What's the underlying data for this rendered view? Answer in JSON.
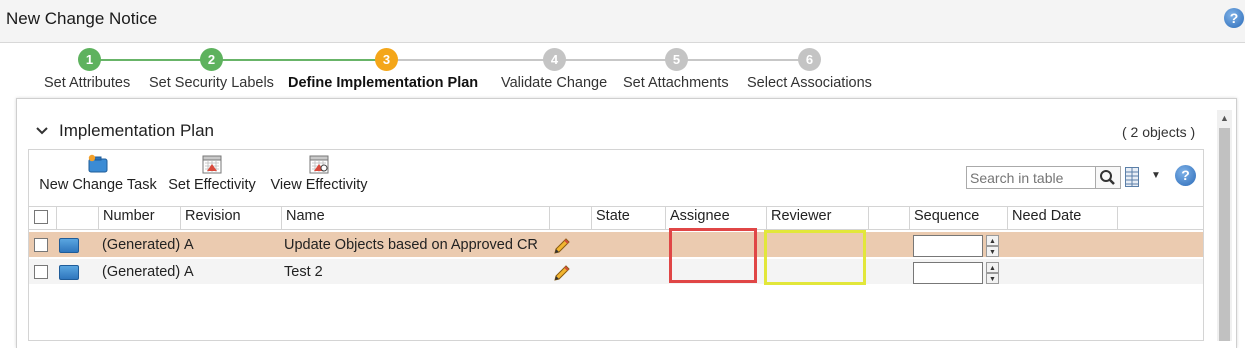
{
  "window": {
    "title": "New Change Notice",
    "help_icon": "?"
  },
  "wizard": {
    "steps": [
      {
        "number": "1",
        "label": "Set Attributes",
        "status": "complete"
      },
      {
        "number": "2",
        "label": "Set Security Labels",
        "status": "complete"
      },
      {
        "number": "3",
        "label": "Define Implementation Plan",
        "status": "active"
      },
      {
        "number": "4",
        "label": "Validate Change",
        "status": "pending"
      },
      {
        "number": "5",
        "label": "Set Attachments",
        "status": "pending"
      },
      {
        "number": "6",
        "label": "Select Associations",
        "status": "pending"
      }
    ]
  },
  "section": {
    "title": "Implementation Plan",
    "object_count": "( 2 objects )"
  },
  "toolbar": {
    "new_change_task": "New Change Task",
    "set_effectivity": "Set Effectivity",
    "view_effectivity": "View Effectivity",
    "search_placeholder": "Search in table",
    "help": "?"
  },
  "table": {
    "columns": [
      "Number",
      "Revision",
      "Name",
      "State",
      "Assignee",
      "Reviewer",
      "Sequence",
      "Need Date"
    ],
    "rows": [
      {
        "number": "(Generated)",
        "revision": "A",
        "name": "Update Objects based on Approved CR",
        "state": "",
        "assignee": "",
        "reviewer": "",
        "sequence": "",
        "need_date": "",
        "selected": true
      },
      {
        "number": "(Generated)",
        "revision": "A",
        "name": "Test 2",
        "state": "",
        "assignee": "",
        "reviewer": "",
        "sequence": "",
        "need_date": "",
        "selected": false
      }
    ]
  },
  "colors": {
    "step_complete": "#5eb25e",
    "step_active": "#f4a619",
    "step_pending": "#c4c4c4",
    "selected_row": "#ebcbb0",
    "highlight_assignee": "#e04646",
    "highlight_reviewer": "#e2e73a"
  }
}
